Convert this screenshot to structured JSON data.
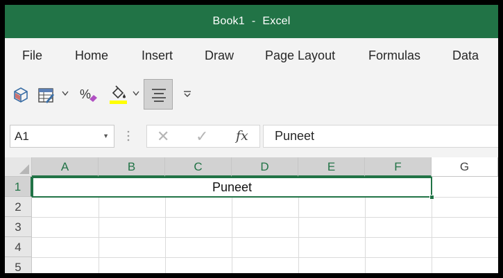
{
  "window": {
    "title_book": "Book1",
    "title_sep": "-",
    "title_app": "Excel"
  },
  "ribbon": {
    "tabs": [
      {
        "label": "File"
      },
      {
        "label": "Home"
      },
      {
        "label": "Insert"
      },
      {
        "label": "Draw"
      },
      {
        "label": "Page Layout"
      },
      {
        "label": "Formulas"
      },
      {
        "label": "Data"
      }
    ]
  },
  "toolbar": {
    "icons": [
      "3d-model-icon",
      "format-table-icon",
      "percent-style-icon",
      "fill-color-icon",
      "align-center-icon",
      "customize-toolbar-icon"
    ],
    "fill_color": "#FFFF00",
    "accent": "#217346"
  },
  "formula_bar": {
    "name_box": "A1",
    "fx_label": "fx",
    "cancel_symbol": "✕",
    "enter_symbol": "✓",
    "value": "Puneet"
  },
  "sheet": {
    "columns": [
      "A",
      "B",
      "C",
      "D",
      "E",
      "F",
      "G"
    ],
    "rows": [
      "1",
      "2",
      "3",
      "4",
      "5"
    ],
    "selected_range": "A1:F1",
    "merged_cell_value": "Puneet"
  }
}
